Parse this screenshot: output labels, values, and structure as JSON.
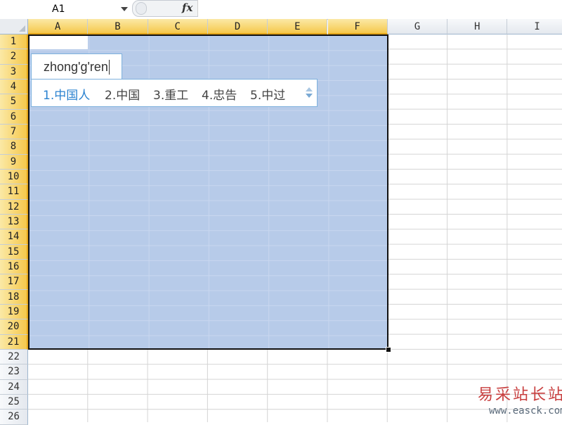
{
  "formula_bar": {
    "name_box": "A1",
    "fx_label": "fx",
    "formula": ""
  },
  "columns": [
    {
      "label": "A",
      "selected": true
    },
    {
      "label": "B",
      "selected": true
    },
    {
      "label": "C",
      "selected": true
    },
    {
      "label": "D",
      "selected": true
    },
    {
      "label": "E",
      "selected": true
    },
    {
      "label": "F",
      "selected": true
    },
    {
      "label": "G",
      "selected": false
    },
    {
      "label": "H",
      "selected": false
    },
    {
      "label": "I",
      "selected": false
    }
  ],
  "rows": [
    "1",
    "2",
    "3",
    "4",
    "5",
    "6",
    "7",
    "8",
    "9",
    "10",
    "11",
    "12",
    "13",
    "14",
    "15",
    "16",
    "17",
    "18",
    "19",
    "20",
    "21",
    "22",
    "23",
    "24",
    "25",
    "26"
  ],
  "selected_rows": 21,
  "ime": {
    "composition": "zhong'g'ren",
    "candidates": [
      "1.中国人",
      "2.中国",
      "3.重工",
      "4.忠告",
      "5.中过"
    ]
  },
  "colors": {
    "selection": "#b7cbe9",
    "header_selected": "#f5c84c",
    "ime_border": "#7eb1dd",
    "ime_first": "#2a82d0"
  },
  "watermark": {
    "cn": "易采站长站",
    "url": "www.easck.com"
  }
}
